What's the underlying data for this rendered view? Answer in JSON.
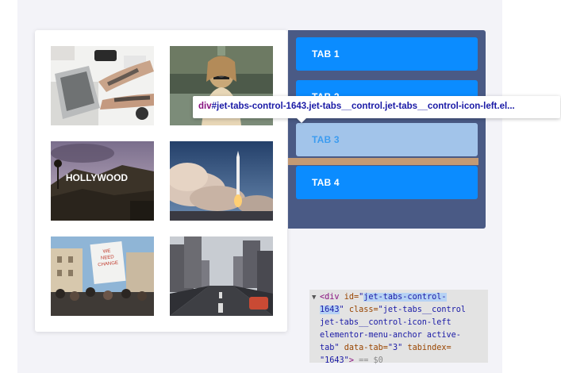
{
  "tabs": [
    {
      "label": "TAB 1",
      "state": "default"
    },
    {
      "label": "TAB 2",
      "state": "default"
    },
    {
      "label": "TAB 3",
      "state": "hovered"
    },
    {
      "label": "TAB 4",
      "state": "default"
    }
  ],
  "gallery": {
    "images": [
      {
        "name": "laptop-tattoo-photo"
      },
      {
        "name": "photographer-camera-photo"
      },
      {
        "name": "hollywood-sign-photo"
      },
      {
        "name": "rocket-launch-photo"
      },
      {
        "name": "protest-crowd-photo",
        "sign_text": "WE NEED CHANGE"
      },
      {
        "name": "city-street-photo"
      }
    ]
  },
  "tooltip": {
    "tag": "div",
    "selector": "#jet-tabs-control-1643.jet-tabs__control.jet-tabs__control-icon-left.el..."
  },
  "devtools": {
    "triangle": "▼",
    "open_tag": "<div",
    "id_attr": "id=",
    "id_value_part1": "jet-tabs-control-",
    "id_value_part2": "1643",
    "class_attr": "class=",
    "class_line1": "\"jet-tabs__control",
    "class_line2": "jet-tabs__control-icon-left",
    "class_line3": "elementor-menu-anchor active-",
    "class_line4": "tab\"",
    "datatab_attr": "data-tab=",
    "datatab_value": "\"3\"",
    "tabindex_attr": "tabindex=",
    "tabindex_value": "\"1643\"",
    "close": ">",
    "console_ref": "== $0"
  },
  "colors": {
    "tab": "#0b8cff",
    "tab_hovered": "#a2c4ea",
    "panel": "#4a5a85",
    "highlight_bar": "#c39a74"
  }
}
